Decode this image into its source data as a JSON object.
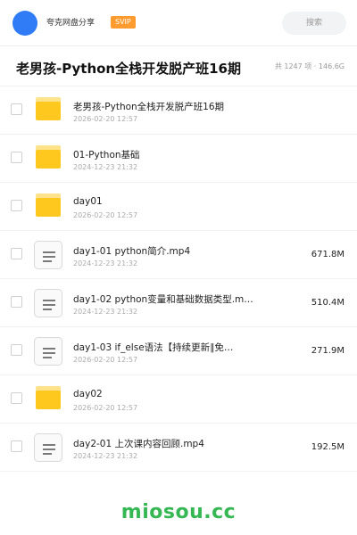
{
  "header": {
    "share_name": "夸克网盘分享",
    "badge": "SVIP",
    "search_label": "搜索",
    "avatar_color": "#2f7cf6",
    "badge_color": "#ff9b2f"
  },
  "folder": {
    "title": "老男孩-Python全栈开发脱产班16期",
    "meta": "共 1247 项 · 146.6G"
  },
  "items": [
    {
      "type": "folder",
      "icon": "folder-icon",
      "name": "老男孩-Python全栈开发脱产班16期",
      "date": "2026-02-20 12:57",
      "size": ""
    },
    {
      "type": "folder",
      "icon": "folder-icon",
      "name": "01-Python基础",
      "date": "2024-12-23 21:32",
      "size": ""
    },
    {
      "type": "folder",
      "icon": "folder-icon",
      "name": "day01",
      "date": "2026-02-20 12:57",
      "size": ""
    },
    {
      "type": "file",
      "icon": "file-icon",
      "name": "day1-01 python简介.mp4",
      "date": "2024-12-23 21:32",
      "size": "671.8M"
    },
    {
      "type": "file",
      "icon": "file-icon",
      "name": "day1-02 python变量和基础数据类型.m…",
      "date": "2024-12-23 21:32",
      "size": "510.4M"
    },
    {
      "type": "file",
      "icon": "file-icon",
      "name": "day1-03 if_else语法【持续更新∥免…",
      "date": "2026-02-20 12:57",
      "size": "271.9M"
    },
    {
      "type": "folder",
      "icon": "folder-icon",
      "name": "day02",
      "date": "2026-02-20 12:57",
      "size": ""
    },
    {
      "type": "file",
      "icon": "file-icon",
      "name": "day2-01 上次课内容回顾.mp4",
      "date": "2024-12-23 21:32",
      "size": "192.5M"
    }
  ],
  "watermark": "miosou.cc",
  "watermark_color": "#35b853"
}
